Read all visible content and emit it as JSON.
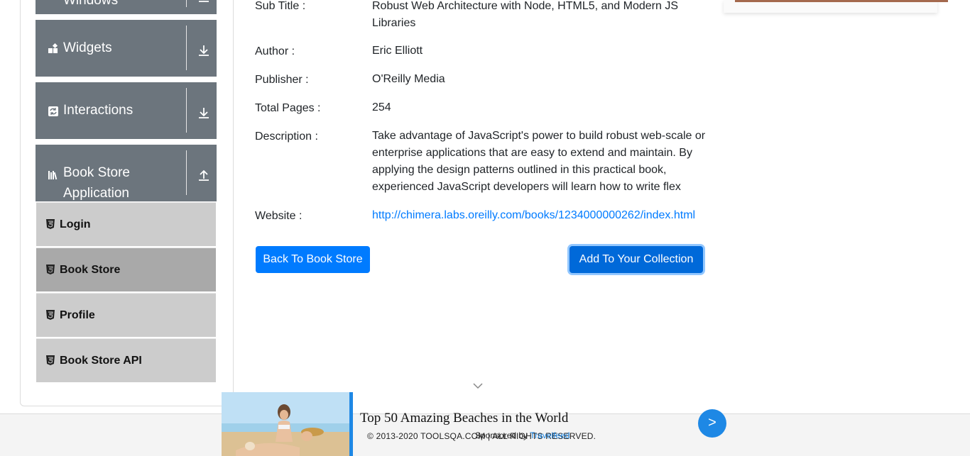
{
  "sidebar": {
    "groups": [
      {
        "label": "Windows"
      },
      {
        "label": "Widgets"
      },
      {
        "label": "Interactions"
      },
      {
        "label": "Book Store Application"
      }
    ],
    "book_store_items": [
      {
        "label": "Login"
      },
      {
        "label": "Book Store"
      },
      {
        "label": "Profile"
      },
      {
        "label": "Book Store API"
      }
    ]
  },
  "book": {
    "subtitle_label": "Sub Title :",
    "subtitle_line1": "Robust Web Architecture with Node, HTML5, and Modern JS",
    "subtitle_line2": "Libraries",
    "author_label": "Author :",
    "author": "Eric Elliott",
    "publisher_label": "Publisher :",
    "publisher": "O'Reilly Media",
    "pages_label": "Total Pages :",
    "pages": "254",
    "description_label": "Description :",
    "description_lines": [
      "Take advantage of JavaScript's power to build robust web-scale or",
      "enterprise applications that are easy to extend and maintain. By",
      "applying the design patterns outlined in this practical book,",
      "experienced JavaScript developers will learn how to write flex"
    ],
    "website_label": "Website :",
    "website": "http://chimera.labs.oreilly.com/books/1234000000262/index.html"
  },
  "actions": {
    "back_label": "Back To Book Store",
    "add_label": "Add To Your Collection"
  },
  "footer": {
    "copyright": "© 2013-2020 TOOLSQA.COM | ALL RIGHTS RESERVED."
  },
  "ad": {
    "title": "Top 50 Amazing Beaches in the World",
    "sponsor_prefix": "Sponsored by",
    "sponsor_name": "Travelfeed",
    "go_label": ">"
  },
  "colors": {
    "primary": "#007bff",
    "sidebar_group": "#6c757d",
    "submenu": "#cccccc",
    "submenu_active": "#a9a9a9"
  }
}
